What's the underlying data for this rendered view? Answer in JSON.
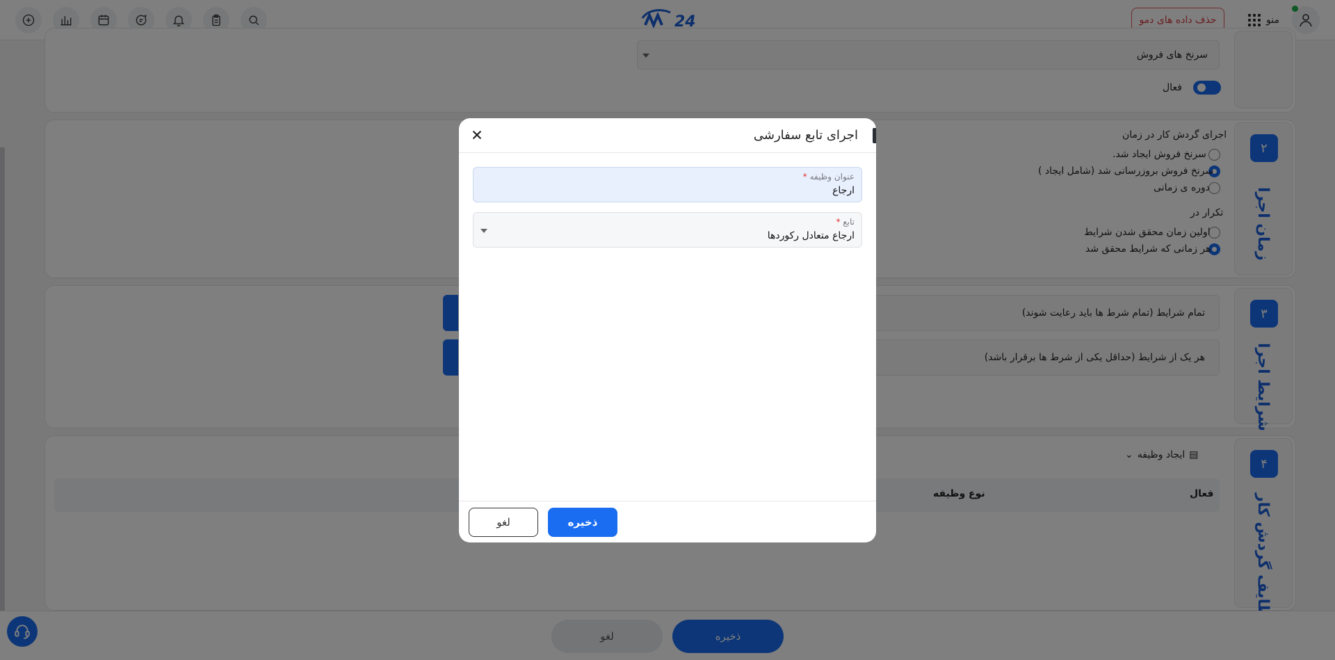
{
  "topbar": {
    "demo_button_label": "حذف داده های دمو",
    "menu_label": "منو",
    "logo_text": "24"
  },
  "workflow": {
    "step1": {
      "select_value": "سرنخ های فروش",
      "active_label": "فعال"
    },
    "step2": {
      "number": "۲",
      "title": "زمان اجرا",
      "run_at_label": "اجرای گردش کار در زمان",
      "options": [
        {
          "label": "سرنخ فروش ایجاد شد.",
          "selected": false
        },
        {
          "label": "سرنخ فروش بروزرسانی شد (شامل ایجاد )",
          "selected": true
        },
        {
          "label": "دوره ی زمانی",
          "selected": false
        }
      ],
      "repeat_label": "تکرار در",
      "repeat_options": [
        {
          "label": "اولین زمان محقق شدن شرایط",
          "selected": false
        },
        {
          "label": "هر زمانی که شرایط محقق شد",
          "selected": true
        }
      ]
    },
    "step3": {
      "number": "۳",
      "title": "شرایط اجرا",
      "all_conditions": "تمام شرایط (تمام شرط ها باید رعایت شوند)",
      "any_conditions": "هر یک از شرایط (حداقل یکی از شرط ها برقرار باشد)"
    },
    "step4": {
      "number": "۴",
      "title": "وظایف گردش کار",
      "create_task_label": "ایجاد وظیفه",
      "columns": [
        "فعال",
        "نوع وظیفه"
      ]
    }
  },
  "bottom_bar": {
    "save_label": "ذخیره",
    "cancel_label": "لغو"
  },
  "modal": {
    "title": "اجرای تابع سفارشی",
    "task_title_label": "عنوان وظیفه",
    "task_title_value": "ارجاع",
    "function_label": "تابع",
    "function_value": "ارجاع متعادل رکوردها",
    "required_mark": "*",
    "save_label": "ذخیره",
    "cancel_label": "لغو"
  },
  "colors": {
    "primary": "#1a6df0",
    "danger": "#d33b40",
    "online": "#21b04b"
  }
}
